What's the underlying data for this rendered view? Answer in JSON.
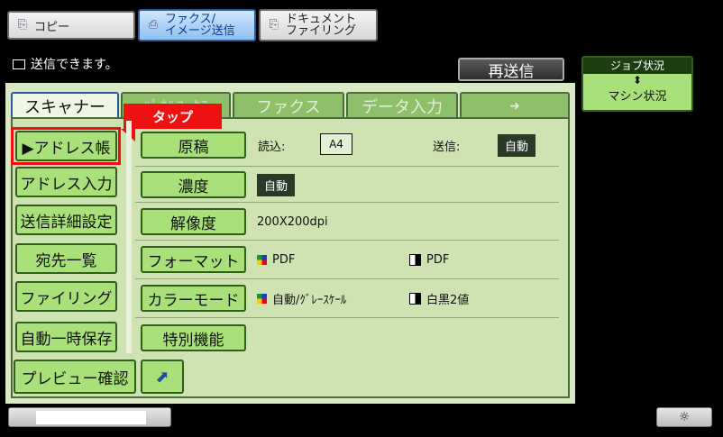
{
  "mode_tabs": {
    "copy": "コピー",
    "fax_line1": "ファクス/",
    "fax_line2": "イメージ送信",
    "doc_line1": "ドキュメント",
    "doc_line2": "ファイリング"
  },
  "status": {
    "message": "送信できます。",
    "resend": "再送信"
  },
  "right_panel": {
    "job_status": "ジョブ状況",
    "machine_status": "マシン状況"
  },
  "tabs": {
    "scanner": "スキャナー",
    "internet_fax": "ﾊﾟﾈﾙﾌｧｸｽ",
    "fax": "ファクス",
    "data_input": "データ入力",
    "more": "➜"
  },
  "callout": "タップ",
  "left_buttons": [
    "▶アドレス帳",
    "アドレス入力",
    "送信詳細設定",
    "宛先一覧",
    "ファイリング",
    "自動一時保存",
    "プレビュー確認"
  ],
  "settings": {
    "original": {
      "label": "原稿",
      "read_label": "読込:",
      "read_value": "A4",
      "send_label": "送信:",
      "send_value": "自動"
    },
    "density": {
      "label": "濃度",
      "value": "自動"
    },
    "resolution": {
      "label": "解像度",
      "value": "200X200dpi"
    },
    "format": {
      "label": "フォーマット",
      "color_value": "PDF",
      "bw_value": "PDF"
    },
    "color_mode": {
      "label": "カラーモード",
      "color_value": "自動/ｸﾞﾚｰｽｹｰﾙ",
      "bw_value": "白黒2値"
    },
    "special": {
      "label": "特別機能"
    }
  },
  "colors": {
    "accent_green": "#a9e07a",
    "callout_red": "#e11",
    "panel_bg": "#cfe3b2"
  }
}
